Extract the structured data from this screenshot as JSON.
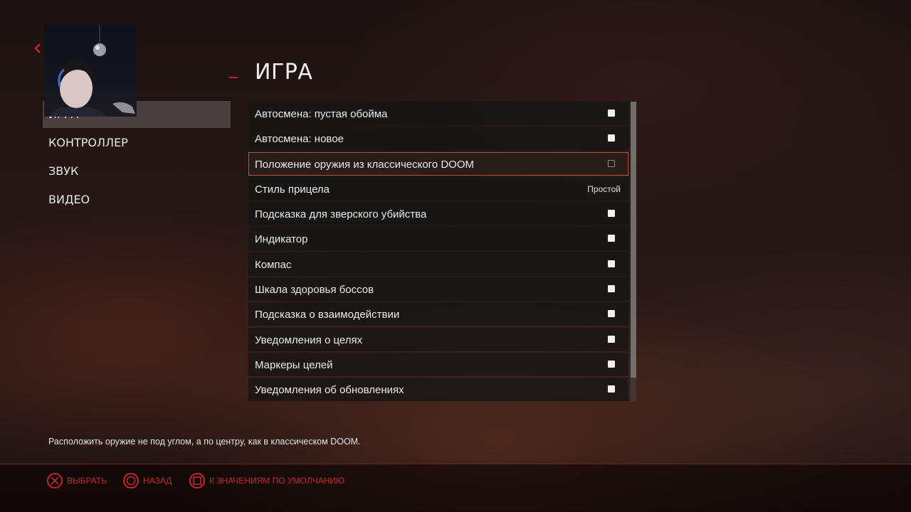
{
  "header": {
    "title": "ИГРА",
    "back_icon": "chevron-left-icon"
  },
  "sidebar": {
    "items": [
      {
        "label": "ИГРА",
        "active": true
      },
      {
        "label": "КОНТРОЛЛЕР",
        "active": false
      },
      {
        "label": "ЗВУК",
        "active": false
      },
      {
        "label": "ВИДЕО",
        "active": false
      }
    ]
  },
  "settings": [
    {
      "label": "Автосмена: пустая обойма",
      "type": "checkbox",
      "checked": true
    },
    {
      "label": "Автосмена: новое",
      "type": "checkbox",
      "checked": true
    },
    {
      "label": "Положение оружия из классического DOOM",
      "type": "checkbox",
      "checked": false,
      "selected": true
    },
    {
      "label": "Стиль прицела",
      "type": "value",
      "value": "Простой"
    },
    {
      "label": "Подсказка для зверского убийства",
      "type": "checkbox",
      "checked": true
    },
    {
      "label": "Индикатор",
      "type": "checkbox",
      "checked": true
    },
    {
      "label": "Компас",
      "type": "checkbox",
      "checked": true
    },
    {
      "label": "Шкала здоровья боссов",
      "type": "checkbox",
      "checked": true
    },
    {
      "label": "Подсказка о взаимодействии",
      "type": "checkbox",
      "checked": true
    },
    {
      "label": "Уведомления о целях",
      "type": "checkbox",
      "checked": true
    },
    {
      "label": "Маркеры целей",
      "type": "checkbox",
      "checked": true
    },
    {
      "label": "Уведомления об обновлениях",
      "type": "checkbox",
      "checked": true
    }
  ],
  "description": "Расположить оружие не под углом, а по центру, как в классическом DOOM.",
  "footer": {
    "prompts": [
      {
        "icon": "cross-button-icon",
        "label": "ВЫБРАТЬ"
      },
      {
        "icon": "circle-button-icon",
        "label": "НАЗАД"
      },
      {
        "icon": "square-button-icon",
        "label": "К ЗНАЧЕНИЯМ ПО УМОЛЧАНИЮ"
      }
    ]
  },
  "colors": {
    "accent": "#c1272d",
    "selected_border": "#b3542a",
    "row_bg": "#161616"
  }
}
